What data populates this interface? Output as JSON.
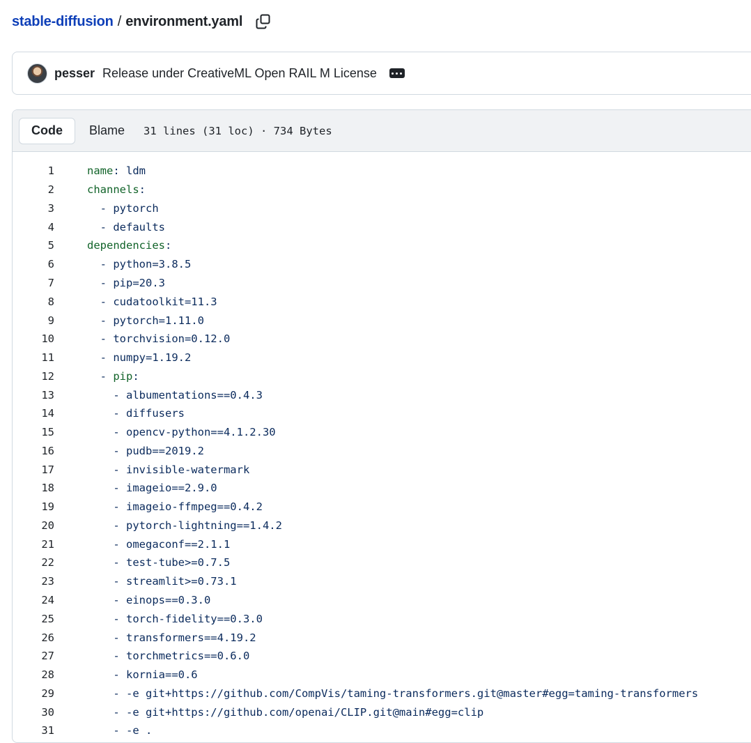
{
  "breadcrumb": {
    "repo": "stable-diffusion",
    "separator": "/",
    "file": "environment.yaml",
    "copy_icon": "copy-icon"
  },
  "commit": {
    "author": "pesser",
    "message": "Release under CreativeML Open RAIL M License",
    "avatar_icon": "avatar"
  },
  "file_header": {
    "code_tab": "Code",
    "blame_tab": "Blame",
    "info": "31 lines (31 loc) · 734 Bytes"
  },
  "lines": [
    {
      "n": "1",
      "text": "name: ldm"
    },
    {
      "n": "2",
      "text": "channels:"
    },
    {
      "n": "3",
      "text": "  - pytorch"
    },
    {
      "n": "4",
      "text": "  - defaults"
    },
    {
      "n": "5",
      "text": "dependencies:"
    },
    {
      "n": "6",
      "text": "  - python=3.8.5"
    },
    {
      "n": "7",
      "text": "  - pip=20.3"
    },
    {
      "n": "8",
      "text": "  - cudatoolkit=11.3"
    },
    {
      "n": "9",
      "text": "  - pytorch=1.11.0"
    },
    {
      "n": "10",
      "text": "  - torchvision=0.12.0"
    },
    {
      "n": "11",
      "text": "  - numpy=1.19.2"
    },
    {
      "n": "12",
      "text": "  - pip:"
    },
    {
      "n": "13",
      "text": "    - albumentations==0.4.3"
    },
    {
      "n": "14",
      "text": "    - diffusers"
    },
    {
      "n": "15",
      "text": "    - opencv-python==4.1.2.30"
    },
    {
      "n": "16",
      "text": "    - pudb==2019.2"
    },
    {
      "n": "17",
      "text": "    - invisible-watermark"
    },
    {
      "n": "18",
      "text": "    - imageio==2.9.0"
    },
    {
      "n": "19",
      "text": "    - imageio-ffmpeg==0.4.2"
    },
    {
      "n": "20",
      "text": "    - pytorch-lightning==1.4.2"
    },
    {
      "n": "21",
      "text": "    - omegaconf==2.1.1"
    },
    {
      "n": "22",
      "text": "    - test-tube>=0.7.5"
    },
    {
      "n": "23",
      "text": "    - streamlit>=0.73.1"
    },
    {
      "n": "24",
      "text": "    - einops==0.3.0"
    },
    {
      "n": "25",
      "text": "    - torch-fidelity==0.3.0"
    },
    {
      "n": "26",
      "text": "    - transformers==4.19.2"
    },
    {
      "n": "27",
      "text": "    - torchmetrics==0.6.0"
    },
    {
      "n": "28",
      "text": "    - kornia==0.6"
    },
    {
      "n": "29",
      "text": "    - -e git+https://github.com/CompVis/taming-transformers.git@master#egg=taming-transformers"
    },
    {
      "n": "30",
      "text": "    - -e git+https://github.com/openai/CLIP.git@main#egg=clip"
    },
    {
      "n": "31",
      "text": "    - -e ."
    }
  ]
}
